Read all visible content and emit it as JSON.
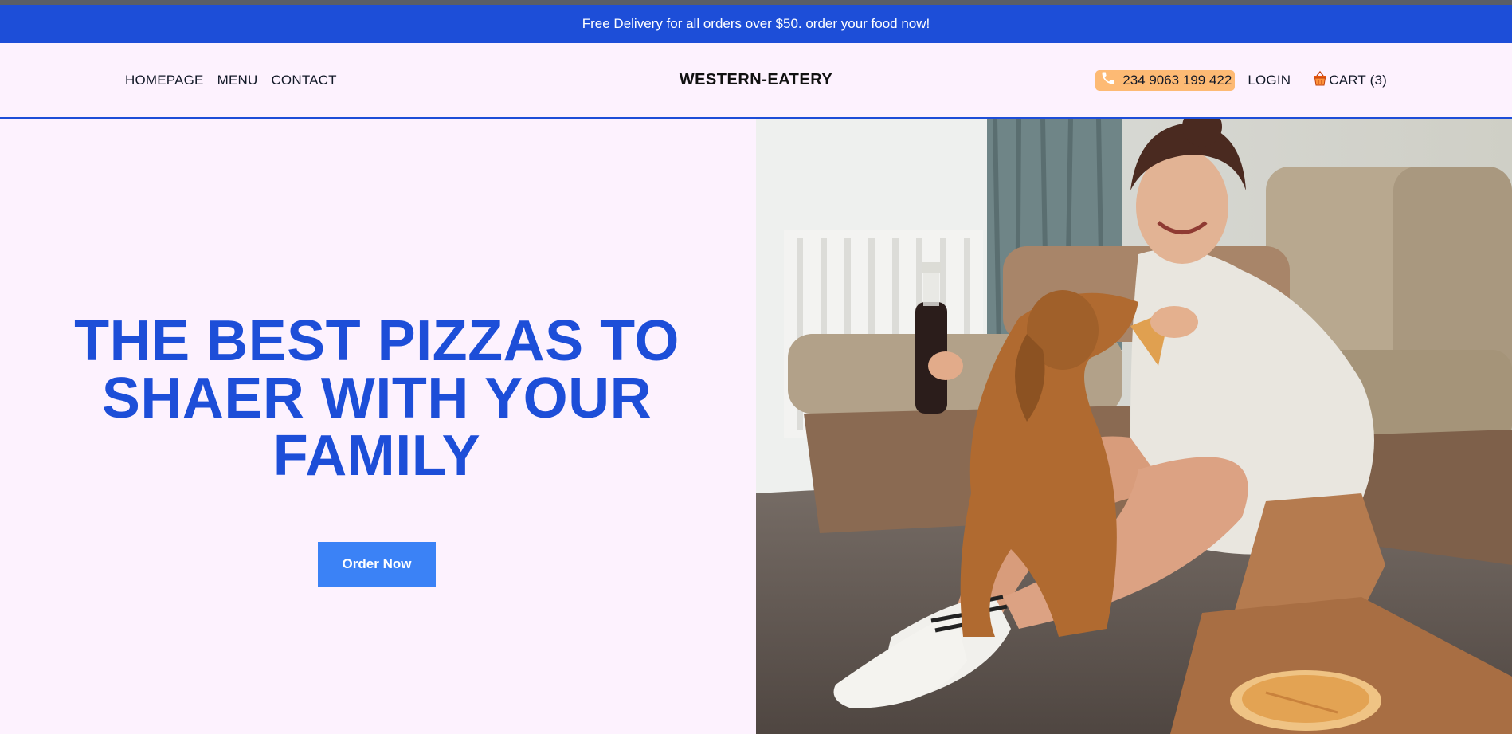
{
  "promo": {
    "text": "Free Delivery for all orders over $50. order your food now!"
  },
  "nav": {
    "links": [
      "HOMEPAGE",
      "MENU",
      "CONTACT"
    ],
    "brand": "WESTERN-EATERY",
    "phone": "234 9063 199 422",
    "login": "LOGIN",
    "cart": "CART (3)"
  },
  "hero": {
    "headline": "THE BEST PIZZAS TO SHAER WITH YOUR FAMILY",
    "cta": "Order Now",
    "image_alt": "Woman sitting on the floor feeding pizza to her dog"
  },
  "icons": {
    "phone": "phone-icon",
    "cart": "basket-icon"
  },
  "colors": {
    "primary_blue": "#1d4ed8",
    "button_blue": "#3b82f6",
    "phone_badge": "#fdba74",
    "background": "#fdf2fe"
  }
}
